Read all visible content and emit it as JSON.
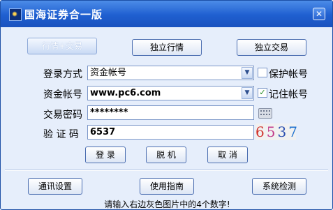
{
  "window": {
    "title": "国海证券合一版",
    "close_glyph": "✕"
  },
  "mode_buttons": {
    "market_trade": "行情+交易",
    "market_only": "独立行情",
    "trade_only": "独立交易"
  },
  "login": {
    "login_mode_label": "登录方式",
    "login_mode_value": "资金帐号",
    "protect_account_label": "保护帐号",
    "protect_account_checked": false,
    "account_label": "资金帐号",
    "account_value": "www.pc6.com",
    "remember_account_label": "记住帐号",
    "remember_account_checked": true,
    "password_label": "交易密码",
    "password_value": "********",
    "captcha_label": "验 证 码",
    "captcha_value": "6537",
    "captcha_image_digits": [
      "6",
      "5",
      "3",
      "7"
    ]
  },
  "actions": {
    "login": "登 录",
    "offline": "脱 机",
    "cancel": "取 消"
  },
  "footer": {
    "comm_settings": "通讯设置",
    "user_guide": "使用指南",
    "system_check": "系统检测",
    "hint": "请输入右边灰色图片中的4个数字!"
  },
  "icons": {
    "combo_arrow": "chevron-down-icon",
    "checkbox_check": "check-icon",
    "soft_keyboard": "keyboard-icon"
  },
  "colors": {
    "titlebar": "#1f5fd0",
    "window_bg": "#e6eefb",
    "button_border": "#4a6db0"
  }
}
